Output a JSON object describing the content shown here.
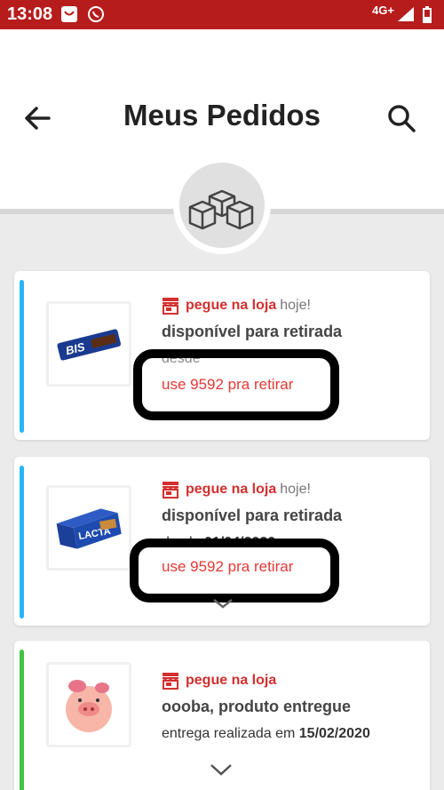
{
  "status_bar": {
    "time": "13:08",
    "network": "4G+",
    "color": "#b71c1c"
  },
  "header": {
    "title": "Meus Pedidos",
    "back_icon": "arrow-left-icon",
    "search_icon": "search-icon"
  },
  "orders": [
    {
      "stripe_color": "#29b6f6",
      "product": "Bis",
      "pickup_label": "pegue na loja",
      "pickup_when": "hoje!",
      "status": "disponível para retirada",
      "subline_prefix": "desde ",
      "subline_date": "",
      "code_text": "use 9592 pra retirar"
    },
    {
      "stripe_color": "#29b6f6",
      "product": "LACTA",
      "pickup_label": "pegue na loja",
      "pickup_when": "hoje!",
      "status": "disponível para retirada",
      "subline_prefix": "desde ",
      "subline_date": "01/04/2020",
      "code_text": "use 9592 pra retirar"
    },
    {
      "stripe_color": "#43c443",
      "product": "piggy-toy",
      "pickup_label": "pegue na loja",
      "pickup_when": "",
      "status": "oooba, produto entregue",
      "subline_prefix": "entrega realizada em ",
      "subline_date": "15/02/2020",
      "code_text": ""
    }
  ]
}
